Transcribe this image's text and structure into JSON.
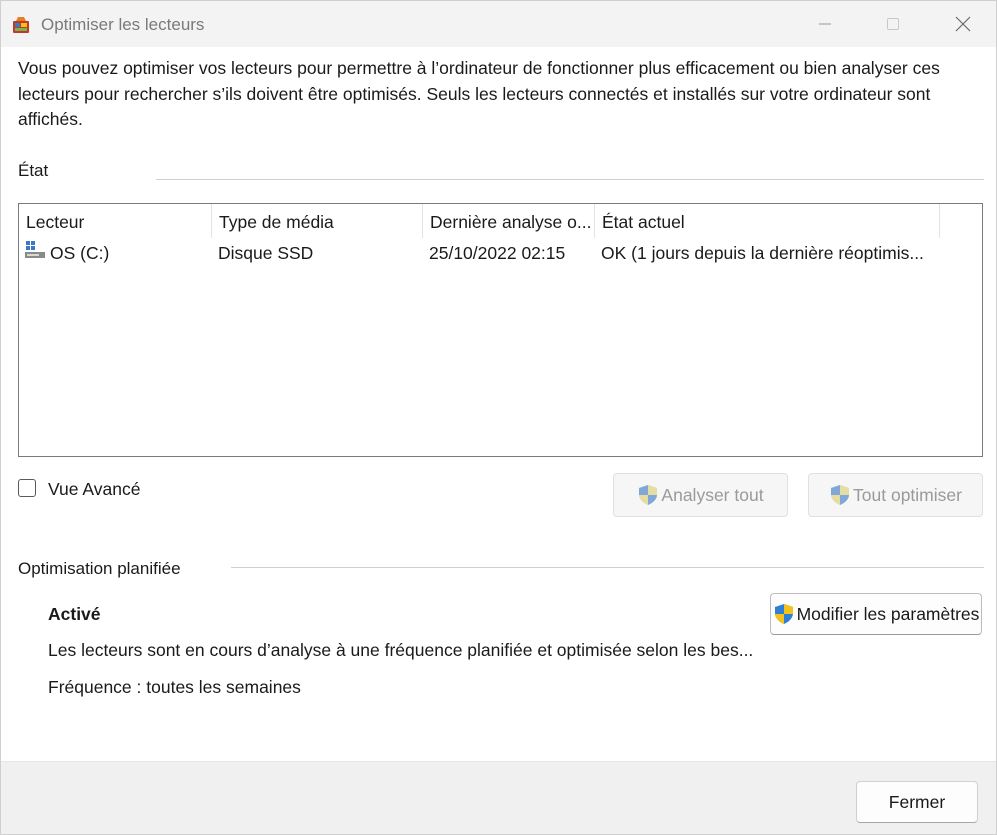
{
  "window": {
    "title": "Optimiser les lecteurs",
    "icon": "defrag-app-icon",
    "controls": [
      "minimize-icon",
      "maximize-icon",
      "close-icon"
    ]
  },
  "description": "Vous pouvez optimiser vos lecteurs pour permettre à l’ordinateur de fonctionner plus efficacement ou bien analyser ces lecteurs pour rechercher s’ils doivent être optimisés. Seuls les lecteurs connectés et installés sur votre ordinateur sont affichés.",
  "status_section": {
    "label": "État",
    "columns": [
      "Lecteur",
      "Type de média",
      "Dernière analyse o...",
      "État actuel"
    ],
    "rows": [
      {
        "drive": "OS (C:)",
        "media_type": "Disque SSD",
        "last_analysis": "25/10/2022 02:15",
        "current_state": "OK (1 jours depuis la dernière réoptimis..."
      }
    ]
  },
  "advanced_view": {
    "label": "Vue Avancé",
    "checked": false
  },
  "actions": {
    "analyze_all": "Analyser tout",
    "optimize_all": "Tout optimiser"
  },
  "scheduled": {
    "label": "Optimisation planifiée",
    "status": "Activé",
    "description": "Les lecteurs sont en cours d’analyse à une fréquence planifiée et optimisée selon les bes...",
    "frequency": "Fréquence : toutes les semaines",
    "modify_button": "Modifier les paramètres"
  },
  "footer": {
    "close_button": "Fermer"
  },
  "colors": {
    "titlebar_bg": "#f3f3f3",
    "footer_bg": "#f0f0f0",
    "shield_blue": "#2f7fd8",
    "shield_yellow": "#f3c21b"
  }
}
